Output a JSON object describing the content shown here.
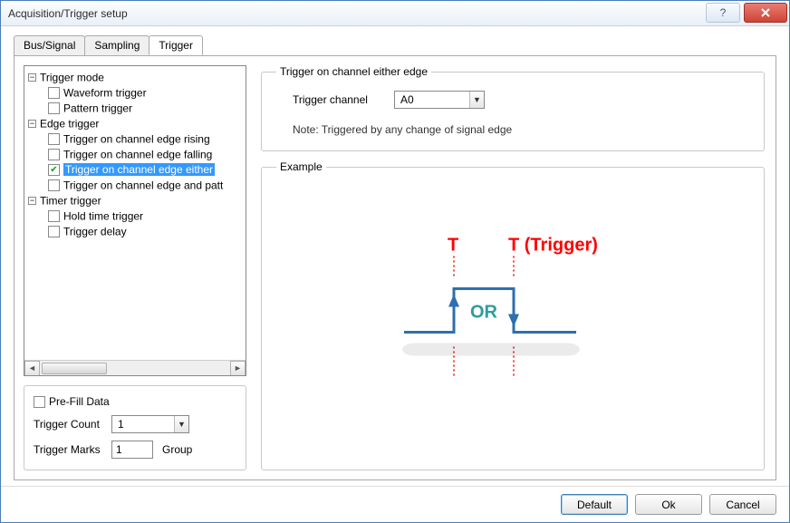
{
  "window": {
    "title": "Acquisition/Trigger setup"
  },
  "tabs": [
    {
      "label": "Bus/Signal",
      "active": false
    },
    {
      "label": "Sampling",
      "active": false
    },
    {
      "label": "Trigger",
      "active": true
    }
  ],
  "tree": {
    "trigger_mode": {
      "label": "Trigger mode",
      "items": [
        {
          "label": "Waveform trigger"
        },
        {
          "label": "Pattern trigger"
        }
      ]
    },
    "edge_trigger": {
      "label": "Edge trigger",
      "items": [
        {
          "label": "Trigger on channel edge rising"
        },
        {
          "label": "Trigger on channel edge falling"
        },
        {
          "label": "Trigger on channel edge either",
          "checked": true,
          "selected": true
        },
        {
          "label": "Trigger on channel edge and patt"
        }
      ]
    },
    "timer_trigger": {
      "label": "Timer trigger",
      "items": [
        {
          "label": "Hold time trigger"
        },
        {
          "label": "Trigger delay"
        }
      ]
    }
  },
  "prefill": {
    "label": "Pre-Fill Data",
    "checked": false
  },
  "trigger_count": {
    "label": "Trigger Count",
    "value": "1"
  },
  "trigger_marks": {
    "label": "Trigger Marks",
    "value": "1",
    "suffix": "Group"
  },
  "panel": {
    "title": "Trigger on channel either edge",
    "channel_label": "Trigger channel",
    "channel_value": "A0",
    "note": "Note: Triggered by any change of signal edge"
  },
  "example": {
    "title": "Example",
    "t1": "T",
    "t2": "T (Trigger)",
    "or": "OR"
  },
  "buttons": {
    "default": "Default",
    "ok": "Ok",
    "cancel": "Cancel"
  }
}
